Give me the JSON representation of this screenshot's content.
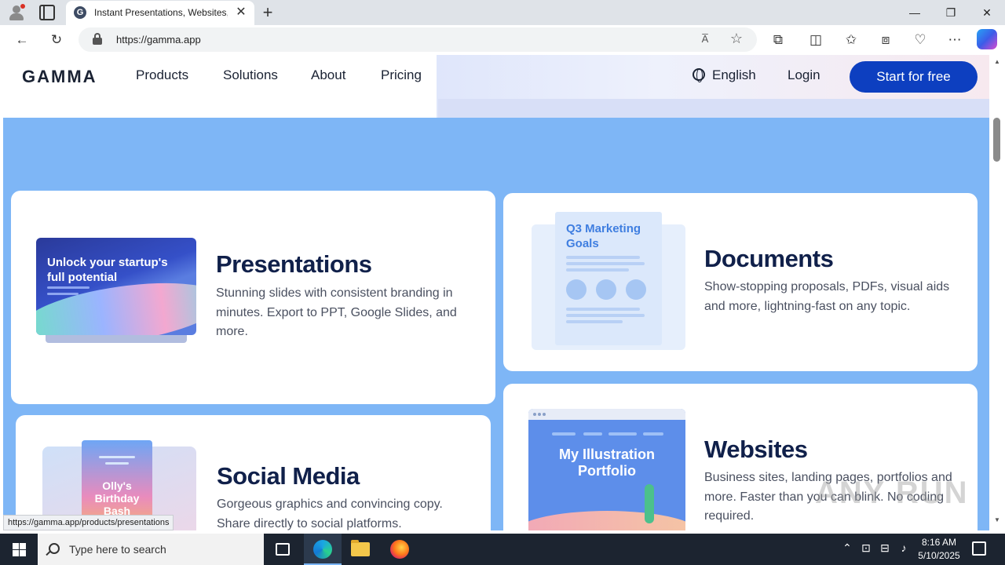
{
  "browser": {
    "tab_title": "Instant Presentations, Websites, &",
    "tab_favicon": "G",
    "tab_close": "✕",
    "new_tab": "+",
    "url": "https://gamma.app",
    "read_aloud": "A̅",
    "minimize": "—",
    "restore": "❐",
    "close": "✕",
    "status_url": "https://gamma.app/products/presentations"
  },
  "nav": {
    "logo": "GAMMA",
    "links": [
      "Products",
      "Solutions",
      "About",
      "Pricing"
    ],
    "language": "English",
    "login": "Login",
    "cta": "Start for free"
  },
  "cards": {
    "presentations": {
      "title": "Presentations",
      "desc": "Stunning slides with consistent branding in minutes. Export to PPT, Google Slides, and more.",
      "thumb_text": "Unlock your startup's full potential"
    },
    "documents": {
      "title": "Documents",
      "desc": "Show-stopping proposals, PDFs, visual aids and more, lightning-fast on any topic.",
      "thumb_text": "Q3 Marketing Goals"
    },
    "social": {
      "title": "Social Media",
      "desc": "Gorgeous graphics and convincing copy. Share directly to social platforms.",
      "thumb_text": "Olly's Birthday Bash"
    },
    "websites": {
      "title": "Websites",
      "desc": "Business sites, landing pages, portfolios and more. Faster than you can blink. No coding required.",
      "thumb_text": "My Illustration Portfolio"
    }
  },
  "watermark": "ANY RUN",
  "taskbar": {
    "search_placeholder": "Type here to search",
    "time": "8:16 AM",
    "date": "5/10/2025"
  }
}
